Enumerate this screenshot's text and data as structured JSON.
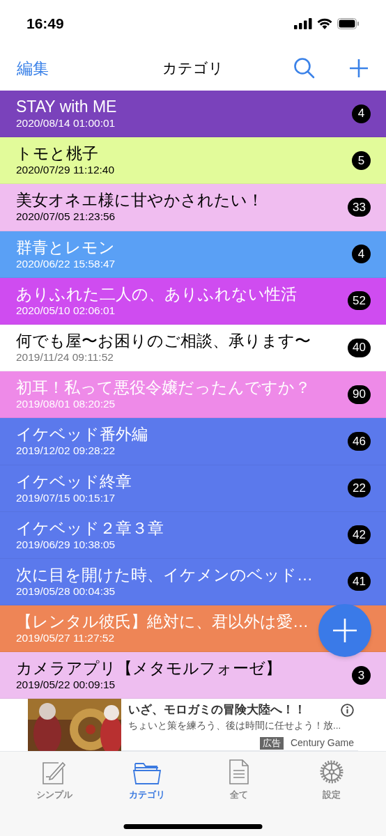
{
  "status_bar": {
    "time": "16:49"
  },
  "nav": {
    "edit": "編集",
    "title": "カテゴリ"
  },
  "categories": [
    {
      "title": "STAY with ME",
      "date": "2020/08/14 01:00:01",
      "count": "4",
      "color": "#7a42bb",
      "kind": "dark"
    },
    {
      "title": "トモと桃子",
      "date": "2020/07/29 11:12:40",
      "count": "5",
      "color": "#e2fb9a",
      "kind": "light"
    },
    {
      "title": "美女オネエ様に甘やかされたい！",
      "date": "2020/07/05 21:23:56",
      "count": "33",
      "color": "#f0bdf0",
      "kind": "light"
    },
    {
      "title": "群青とレモン",
      "date": "2020/06/22 15:58:47",
      "count": "4",
      "color": "#5aa0f5",
      "kind": "dark"
    },
    {
      "title": "ありふれた二人の、ありふれない性活",
      "date": "2020/05/10 02:06:01",
      "count": "52",
      "color": "#cf4cf0",
      "kind": "dark"
    },
    {
      "title": "何でも屋〜お困りのご相談、承ります〜",
      "date": "2019/11/24 09:11:52",
      "count": "40",
      "color": "#ffffff",
      "kind": "light"
    },
    {
      "title": "初耳！私って悪役令嬢だったんですか？",
      "date": "2019/08/01 08:20:25",
      "count": "90",
      "color": "#ee8ae8",
      "kind": "dark"
    },
    {
      "title": "イケベッド番外編",
      "date": "2019/12/02 09:28:22",
      "count": "46",
      "color": "#5b79ec",
      "kind": "dark"
    },
    {
      "title": "イケベッド終章",
      "date": "2019/07/15 00:15:17",
      "count": "22",
      "color": "#5b79ec",
      "kind": "dark"
    },
    {
      "title": "イケベッド２章３章",
      "date": "2019/06/29 10:38:05",
      "count": "42",
      "color": "#5b79ec",
      "kind": "dark"
    },
    {
      "title": "次に目を開けた時、イケメンのベッド…",
      "date": "2019/05/28 00:04:35",
      "count": "41",
      "color": "#5b79ec",
      "kind": "dark"
    },
    {
      "title": "【レンタル彼氏】絶対に、君以外は愛…",
      "date": "2019/05/27 11:27:52",
      "color": "#ee8556",
      "kind": "dark"
    },
    {
      "title": "カメラアプリ【メタモルフォーゼ】",
      "date": "2019/05/22 00:09:15",
      "count": "3",
      "color": "#eebef0",
      "kind": "light"
    }
  ],
  "ad": {
    "headline": "いざ、モロガミの冒険大陸へ！！",
    "body": "ちょいと策を練ろう、後は時間に任せよう！放...",
    "tag": "広告",
    "advertiser": "Century Game"
  },
  "tabs": [
    {
      "label": "シンプル",
      "kind": "note",
      "selected": false
    },
    {
      "label": "カテゴリ",
      "kind": "folder",
      "selected": true
    },
    {
      "label": "全て",
      "kind": "doc",
      "selected": false
    },
    {
      "label": "設定",
      "kind": "gear",
      "selected": false
    }
  ]
}
